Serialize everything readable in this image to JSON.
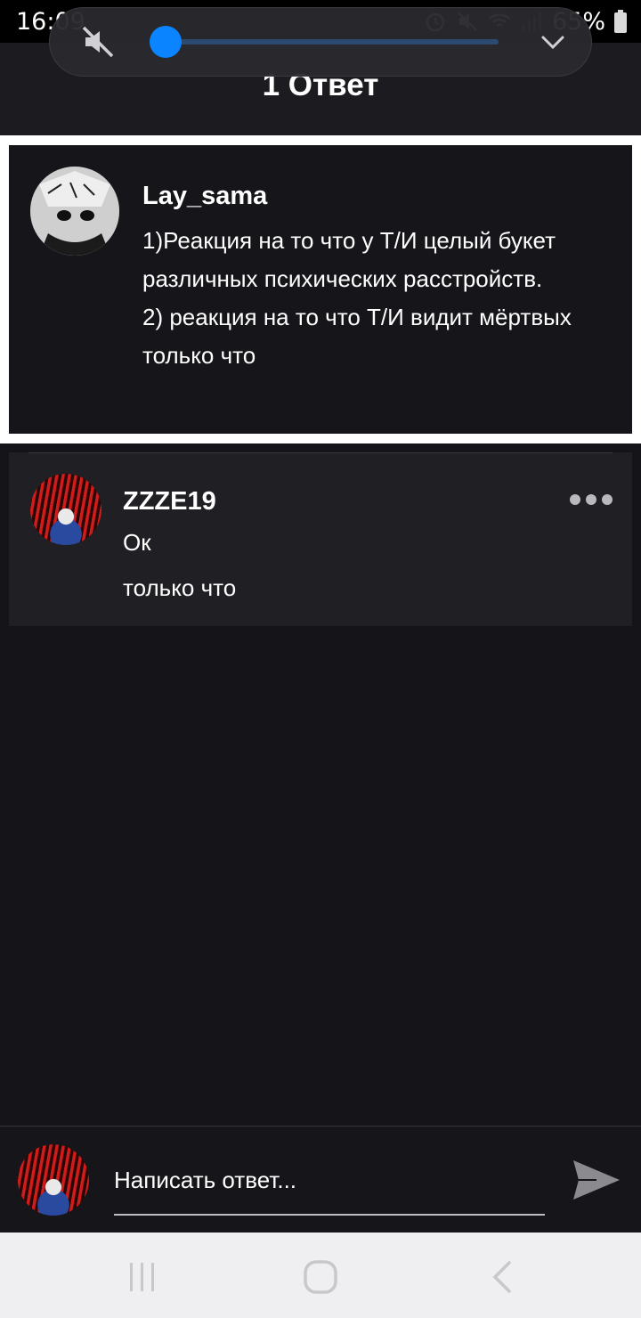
{
  "status_bar": {
    "time": "16:09",
    "battery_text": "65%"
  },
  "header": {
    "title": "1 Ответ"
  },
  "volume": {
    "level_percent": 3,
    "muted": true,
    "accent_color": "#0a84ff"
  },
  "parent_comment": {
    "author": "Lay_sama",
    "text": "1)Реакция на то что у Т/И целый букет различных психических расстройств.\n2) реакция на то что Т/И видит мёртвых",
    "time": "только что"
  },
  "reply": {
    "author": "ZZZE19",
    "text": "Ок",
    "time": "только что"
  },
  "composer": {
    "placeholder": "Написать ответ..."
  },
  "icons": {
    "mute": "volume-mute-icon",
    "expand": "chevron-down-icon",
    "send": "send-icon",
    "more": "more-dots-icon"
  }
}
